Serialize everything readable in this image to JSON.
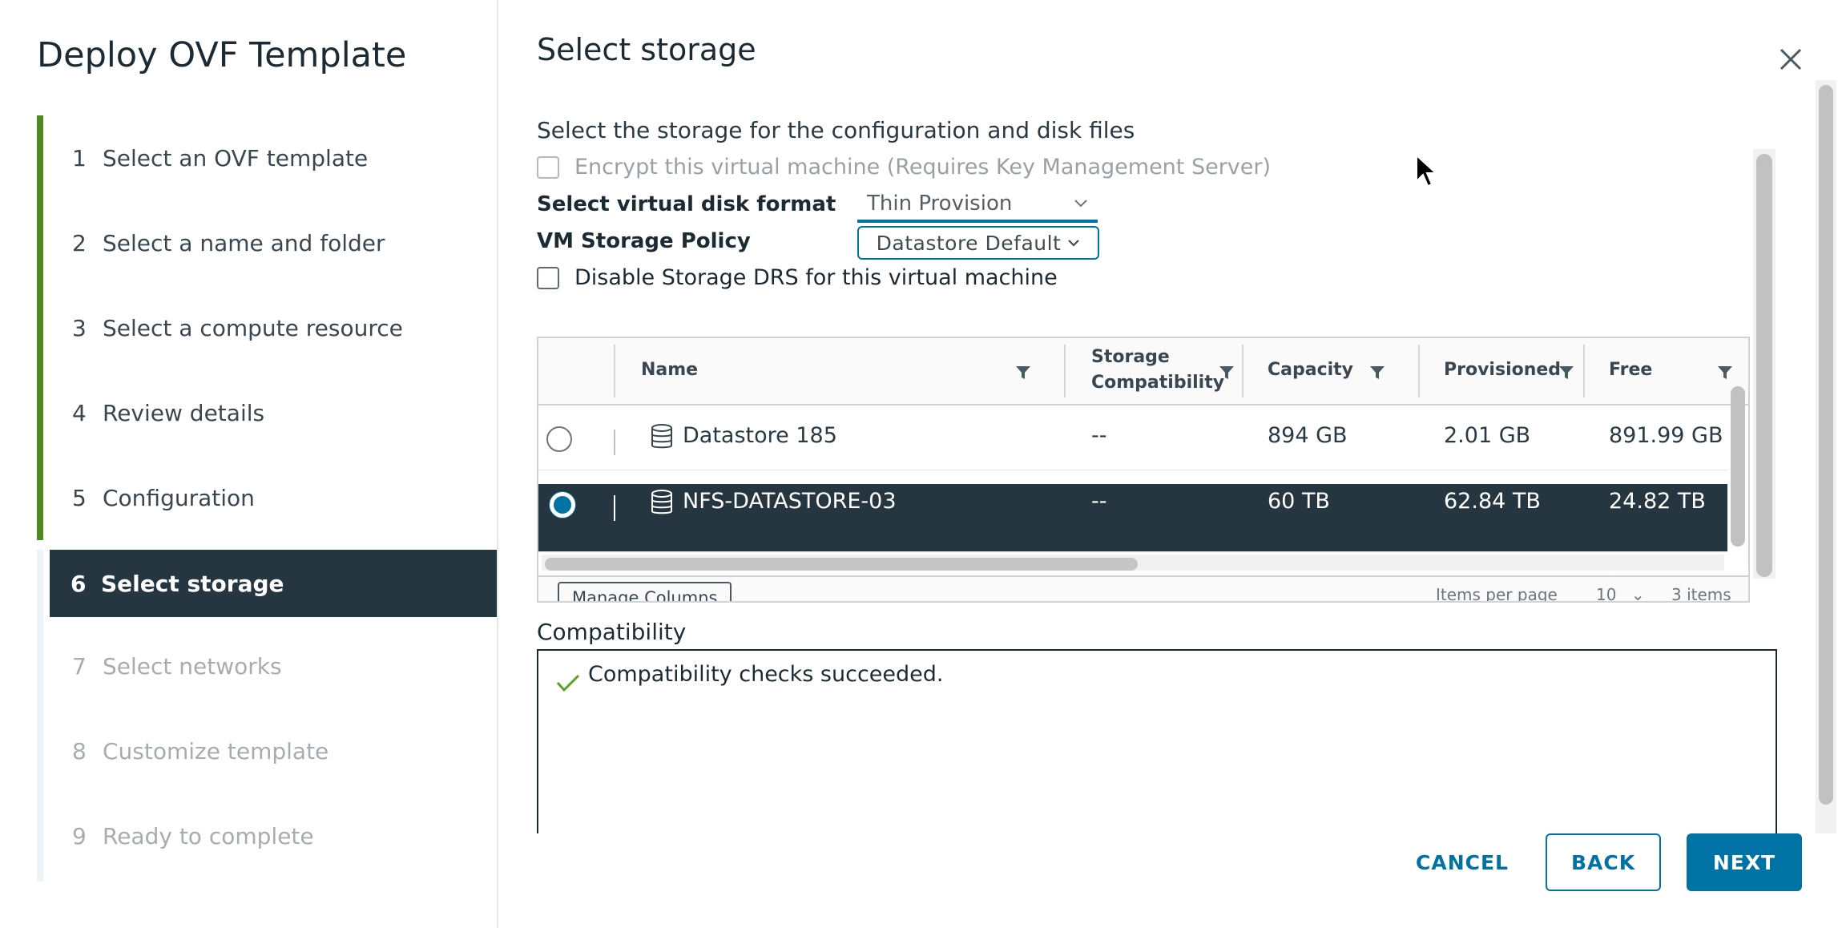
{
  "wizard": {
    "title": "Deploy OVF Template",
    "steps": [
      {
        "num": "1",
        "label": "Select an OVF template",
        "state": "done"
      },
      {
        "num": "2",
        "label": "Select a name and folder",
        "state": "done"
      },
      {
        "num": "3",
        "label": "Select a compute resource",
        "state": "done"
      },
      {
        "num": "4",
        "label": "Review details",
        "state": "done"
      },
      {
        "num": "5",
        "label": "Configuration",
        "state": "done"
      },
      {
        "num": "6",
        "label": "Select storage",
        "state": "active"
      },
      {
        "num": "7",
        "label": "Select networks",
        "state": "todo"
      },
      {
        "num": "8",
        "label": "Customize template",
        "state": "todo"
      },
      {
        "num": "9",
        "label": "Ready to complete",
        "state": "todo"
      }
    ]
  },
  "main": {
    "title": "Select storage",
    "subtitle": "Select the storage for the configuration and disk files",
    "encrypt_label": "Encrypt this virtual machine (Requires Key Management Server)",
    "encrypt_checked": false,
    "disk_format_label": "Select virtual disk format",
    "disk_format_value": "Thin Provision",
    "policy_label": "VM Storage Policy",
    "policy_value": "Datastore Default",
    "disable_drs_label": "Disable Storage DRS for this virtual machine",
    "disable_drs_checked": false
  },
  "grid": {
    "columns": [
      "Name",
      "Storage",
      "Compatibility",
      "Capacity",
      "Provisioned",
      "Free"
    ],
    "rows": [
      {
        "name": "Datastore 185",
        "compat": "--",
        "capacity": "894 GB",
        "provisioned": "2.01 GB",
        "free": "891.99 GB",
        "selected": false
      },
      {
        "name": "NFS-DATASTORE-03",
        "compat": "--",
        "capacity": "60 TB",
        "provisioned": "62.84 TB",
        "free": "24.82 TB",
        "selected": true
      }
    ],
    "footer": {
      "manage_columns": "Manage Columns",
      "items_per_page_label": "Items per page",
      "items_per_page_value": "10",
      "item_count": "3 items"
    }
  },
  "compatibility": {
    "label": "Compatibility",
    "message": "Compatibility checks succeeded."
  },
  "buttons": {
    "cancel": "CANCEL",
    "back": "BACK",
    "next": "NEXT"
  },
  "colors": {
    "accent": "#0072a3",
    "progress_done": "#4e8a22",
    "nav_active_bg": "#253641",
    "success": "#5aa220"
  }
}
